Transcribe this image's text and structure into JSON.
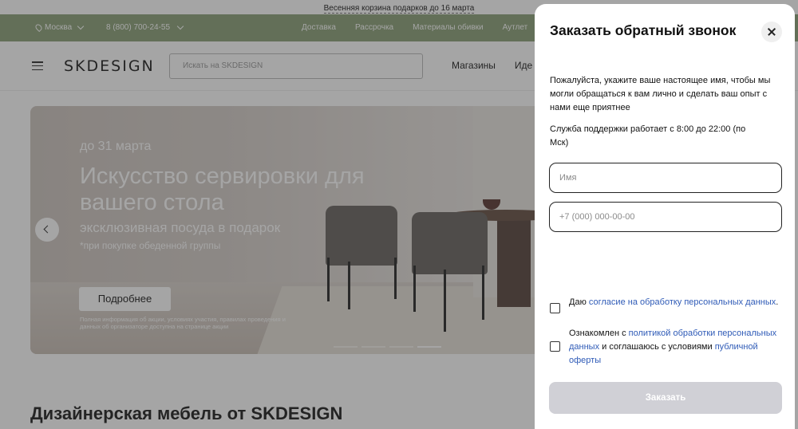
{
  "promo": {
    "text": "Весенняя корзина подарков до 16 марта"
  },
  "topbar": {
    "city": "Москва",
    "phone": "8 (800) 700-24-55",
    "nav": [
      "Доставка",
      "Рассрочка",
      "Материалы обивки",
      "Аутлет"
    ]
  },
  "header": {
    "logo": "SKDESIGN",
    "search_placeholder": "Искать на SKDESIGN",
    "nav": [
      "Магазины",
      "Иде"
    ]
  },
  "hero": {
    "date": "до 31 марта",
    "title": "Искусство сервировки для вашего стола",
    "subtitle": "эксклюзивная посуда в подарок",
    "note": "*при покупке обеденной группы",
    "button": "Подробнее",
    "fine_print": "Полная информация об акции, условиях участия, правилах проведения и данных об организаторе доступна на странице акции",
    "slides": 4,
    "active_slide": 4
  },
  "section_title": "Дизайнерская мебель от SKDESIGN",
  "modal": {
    "title": "Заказать обратный звонок",
    "description": "Пожалуйста, укажите ваше настоящее имя, чтобы мы могли обращаться к вам лично и сделать ваш опыт с нами еще приятнее",
    "hours": "Служба поддержки работает с 8:00 до 22:00 (по Мск)",
    "name_placeholder": "Имя",
    "phone_placeholder": "+7 (000) 000-00-00",
    "consent": {
      "prefix": "Даю ",
      "link": "согласие на обработку персональных данных",
      "suffix": "."
    },
    "policy": {
      "prefix": "Ознакомлен с ",
      "link1": "политикой обработки персональных данных",
      "middle": " и соглашаюсь с условиями ",
      "link2": "публичной оферты"
    },
    "submit": "Заказать"
  },
  "colors": {
    "topbar": "#8da37a",
    "link": "#2f5bb7",
    "submit_disabled": "#d0d0d6"
  }
}
